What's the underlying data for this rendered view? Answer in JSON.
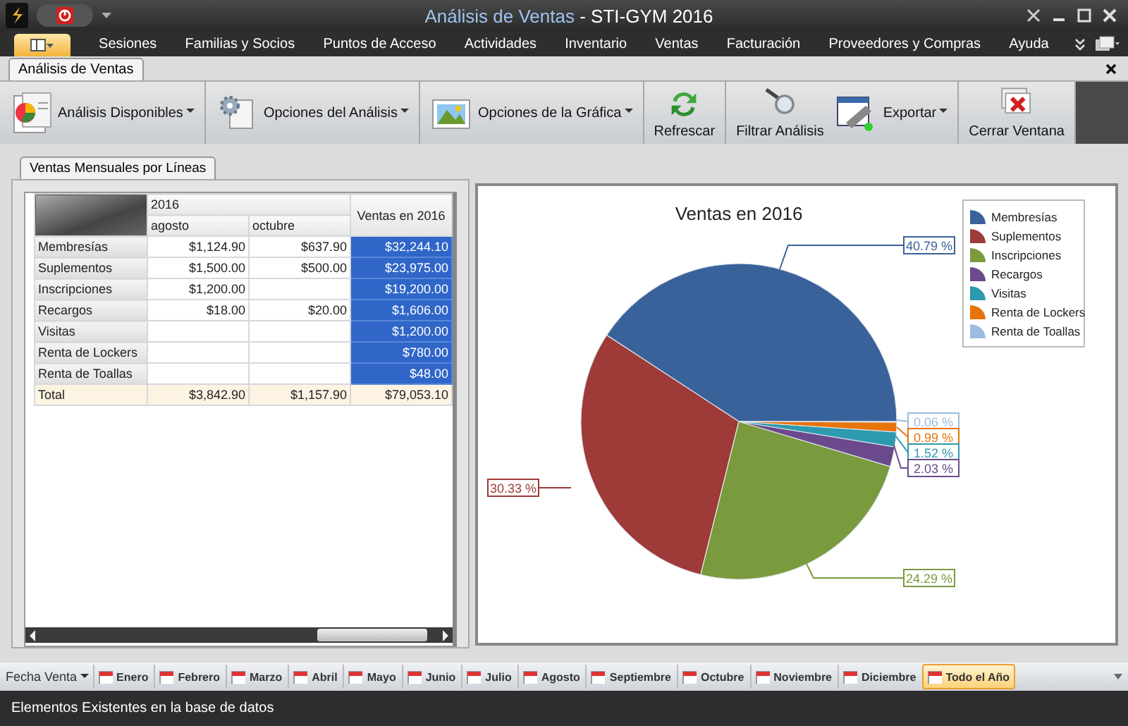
{
  "window": {
    "title_parts": [
      "Análisis de Ventas",
      " - STI-GYM 2016"
    ]
  },
  "menu": {
    "items": [
      "Sesiones",
      "Familias y Socios",
      "Puntos de Acceso",
      "Actividades",
      "Inventario",
      "Ventas",
      "Facturación",
      "Proveedores y Compras",
      "Ayuda"
    ]
  },
  "document_tabs": [
    {
      "label": "Análisis de Ventas",
      "selected": true
    }
  ],
  "ribbon": {
    "groups": [
      [
        {
          "label": "Análisis Disponibles",
          "kind": "dropdown"
        }
      ],
      [
        {
          "label": "Opciones del Análisis",
          "kind": "dropdown"
        }
      ],
      [
        {
          "label": "Opciones de la Gráfica",
          "kind": "dropdown"
        }
      ],
      [
        {
          "label": "Refrescar",
          "kind": "large"
        }
      ],
      [
        {
          "label": "Filtrar Análisis",
          "kind": "large"
        },
        {
          "label": "Exportar",
          "kind": "dropdown"
        }
      ],
      [
        {
          "label": "Cerrar Ventana",
          "kind": "large"
        }
      ]
    ]
  },
  "analysis_tabs": [
    {
      "label": "Ventas Mensuales por Líneas",
      "selected": true
    }
  ],
  "grid": {
    "year": "2016",
    "columns": [
      "agosto",
      "octubre"
    ],
    "total_column": "Ventas en 2016",
    "rows": [
      {
        "label": "Membresías",
        "values": [
          "$1,124.90",
          "$637.90"
        ],
        "total": "$32,244.10"
      },
      {
        "label": "Suplementos",
        "values": [
          "$1,500.00",
          "$500.00"
        ],
        "total": "$23,975.00"
      },
      {
        "label": "Inscripciones",
        "values": [
          "$1,200.00"
        ],
        "total": "$19,200.00"
      },
      {
        "label": "Recargos",
        "values": [
          "$18.00",
          "$20.00"
        ],
        "total": "$1,606.00"
      },
      {
        "label": "Visitas",
        "total": "$1,200.00"
      },
      {
        "label": "Renta de Lockers",
        "total": "$780.00"
      },
      {
        "label": "Renta de Toallas",
        "total": "$48.00"
      }
    ],
    "total_row": {
      "label": "Total",
      "values": [
        "$3,842.90",
        "$1,157.90"
      ],
      "total": "$79,053.10"
    }
  },
  "chart": {
    "chart_data": {
      "type": "pie",
      "title": "Ventas en 2016",
      "categories": [
        "Membresías",
        "Suplementos",
        "Inscripciones",
        "Recargos",
        "Visitas",
        "Renta de Lockers",
        "Renta de Toallas"
      ],
      "series": [
        {
          "values": [
            40.79,
            30.33,
            24.29,
            2.03,
            1.52,
            0.99,
            0.06
          ]
        }
      ],
      "colors": [
        "#3a629a",
        "#9e3a38",
        "#7a9a3e",
        "#6a4a8c",
        "#2e9aae",
        "#e8740c",
        "#9cbce0"
      ],
      "legend": "right"
    },
    "slice_labels": [
      {
        "text": "40.79 %",
        "color": "#3a629a"
      },
      {
        "text": "0.06 %",
        "color": "#9cbce0"
      },
      {
        "text": "0.99 %",
        "color": "#e8740c"
      },
      {
        "text": "1.52 %",
        "color": "#2e9aae"
      },
      {
        "text": "2.03 %",
        "color": "#6a4a8c"
      },
      {
        "text": "30.33 %",
        "color": "#9e3a38"
      },
      {
        "text": "24.29 %",
        "color": "#7a9a3e"
      }
    ]
  },
  "month_filter": {
    "label": "Fecha Venta",
    "items": [
      {
        "label": "Enero",
        "selected": false
      },
      {
        "label": "Febrero",
        "selected": false
      },
      {
        "label": "Marzo",
        "selected": false
      },
      {
        "label": "Abril",
        "selected": false
      },
      {
        "label": "Mayo",
        "selected": false
      },
      {
        "label": "Junio",
        "selected": false
      },
      {
        "label": "Julio",
        "selected": false
      },
      {
        "label": "Agosto",
        "selected": false
      },
      {
        "label": "Septiembre",
        "selected": false
      },
      {
        "label": "Octubre",
        "selected": false
      },
      {
        "label": "Noviembre",
        "selected": false
      },
      {
        "label": "Diciembre",
        "selected": false
      },
      {
        "label": "Todo el Año",
        "selected": true
      }
    ]
  },
  "status_bar": "Elementos Existentes en la base de datos"
}
